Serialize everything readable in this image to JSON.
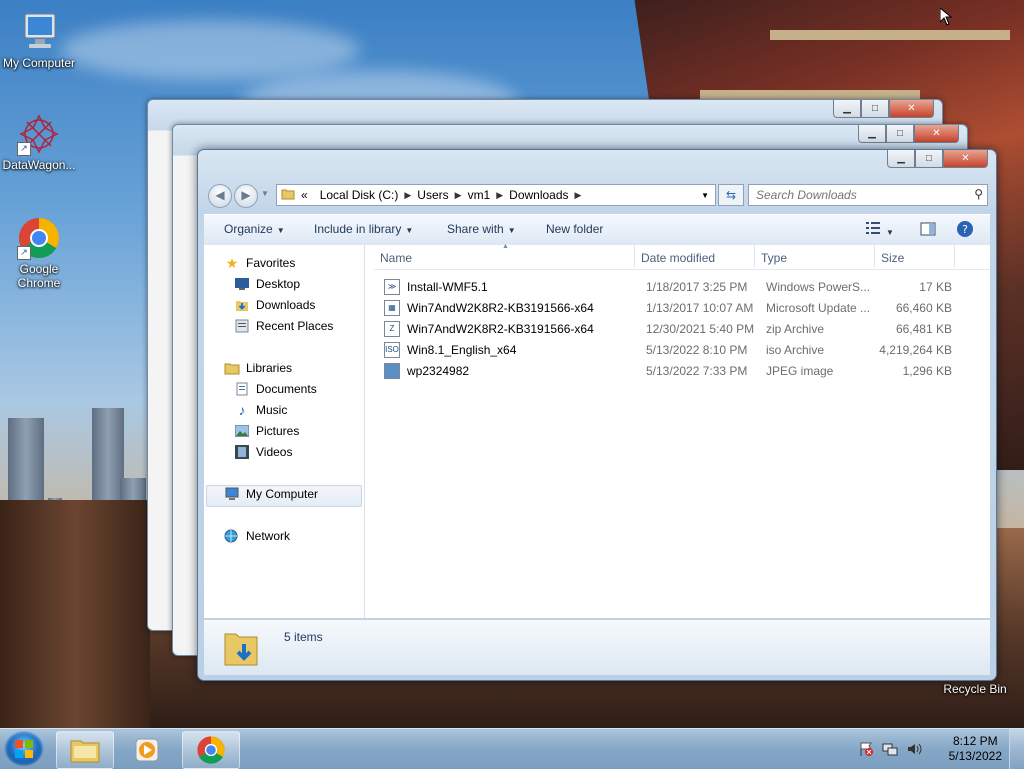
{
  "desktop": {
    "icons": [
      {
        "label": "My Computer"
      },
      {
        "label": "DataWagon..."
      },
      {
        "label": "Google Chrome"
      },
      {
        "label": "Recycle Bin"
      }
    ]
  },
  "window": {
    "buttons": {
      "minimize": "▁",
      "maximize": "□",
      "close": "✕"
    },
    "address": {
      "crumbs": [
        "«",
        "Local Disk (C:)",
        "Users",
        "vm1",
        "Downloads"
      ]
    },
    "search": {
      "placeholder": "Search Downloads"
    },
    "toolbar": {
      "organize": "Organize",
      "include": "Include in library",
      "share": "Share with",
      "new_folder": "New folder"
    },
    "nav": {
      "favorites": "Favorites",
      "desktop": "Desktop",
      "downloads": "Downloads",
      "recent": "Recent Places",
      "libraries": "Libraries",
      "documents": "Documents",
      "music": "Music",
      "pictures": "Pictures",
      "videos": "Videos",
      "computer": "My Computer",
      "network": "Network"
    },
    "columns": {
      "name": "Name",
      "date": "Date modified",
      "type": "Type",
      "size": "Size"
    },
    "files": [
      {
        "name": "Install-WMF5.1",
        "date": "1/18/2017 3:25 PM",
        "type": "Windows PowerS...",
        "size": "17 KB",
        "icon": "ps1-icon"
      },
      {
        "name": "Win7AndW2K8R2-KB3191566-x64",
        "date": "1/13/2017 10:07 AM",
        "type": "Microsoft Update ...",
        "size": "66,460 KB",
        "icon": "msu-icon"
      },
      {
        "name": "Win7AndW2K8R2-KB3191566-x64",
        "date": "12/30/2021 5:40 PM",
        "type": "zip Archive",
        "size": "66,481 KB",
        "icon": "zip-icon"
      },
      {
        "name": "Win8.1_English_x64",
        "date": "5/13/2022 8:10 PM",
        "type": "iso Archive",
        "size": "4,219,264 KB",
        "icon": "iso-icon"
      },
      {
        "name": "wp2324982",
        "date": "5/13/2022 7:33 PM",
        "type": "JPEG image",
        "size": "1,296 KB",
        "icon": "jpeg-icon"
      }
    ],
    "status": {
      "count": "5 items"
    }
  },
  "taskbar": {
    "time": "8:12 PM",
    "date": "5/13/2022"
  },
  "colors": {
    "accent": "#1e395b",
    "selection": "#e4ecf5"
  }
}
